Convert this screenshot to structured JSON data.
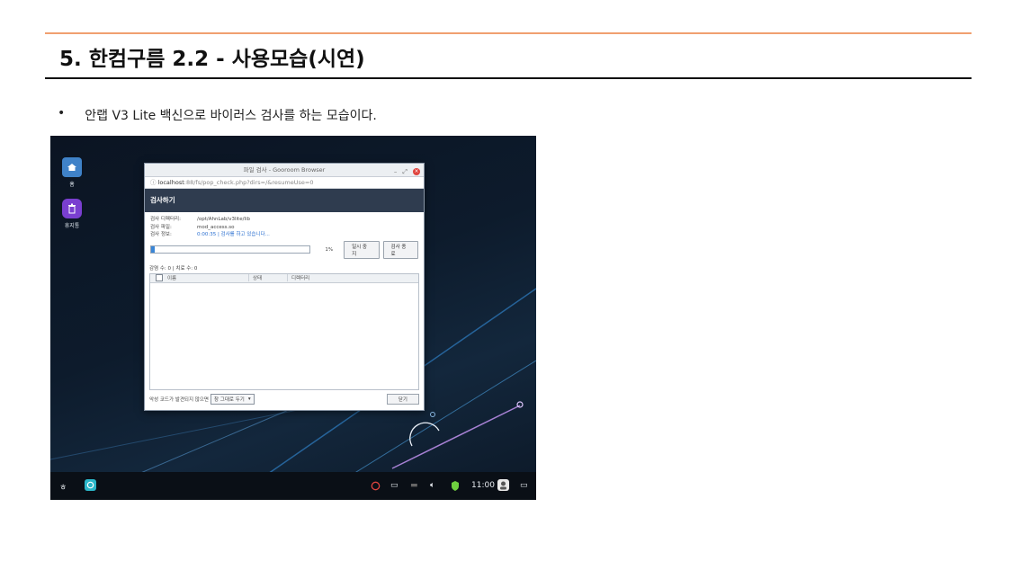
{
  "slide": {
    "title": "5. 한컴구름 2.2 - 사용모습(시연)",
    "bullet_mark": "•",
    "bullet_text": "안랩 V3 Lite 백신으로 바이러스 검사를 하는 모습이다."
  },
  "desktop": {
    "home_label": "홈",
    "trash_label": "휴지통"
  },
  "window": {
    "title": "파일 검사 - Gooroom Browser",
    "url_host": "localhost",
    "url_rest": ":88/fs/pop_check.php?dirs=/&resumeUse=0",
    "header": "검사하기",
    "dir_label": "검사 디렉터리:",
    "dir_value": "/opt/AhnLab/v3lite/lib",
    "file_label": "검사 파일:",
    "file_value": "mod_access.so",
    "info_label": "검사 정보:",
    "info_value": "0:00:35 | 검사를 하고 있습니다...",
    "progress_fraction": 0.01,
    "progress_text": "1%",
    "pause_button": "일시 중지",
    "stop_button": "검사 종료",
    "counts": "감염 수: 0 | 치료 수: 0",
    "col_name": "이름",
    "col_status": "상태",
    "col_dir": "디렉터리",
    "footer_label": "악성 코드가 발견되지 않으면",
    "select_value": "창 그대로 두기",
    "close_button": "닫기"
  },
  "taskbar": {
    "time": "11:00"
  },
  "colors": {
    "accent_rule": "#f0a070",
    "window_header": "#2f3c4f",
    "progress": "#3a86d6"
  }
}
